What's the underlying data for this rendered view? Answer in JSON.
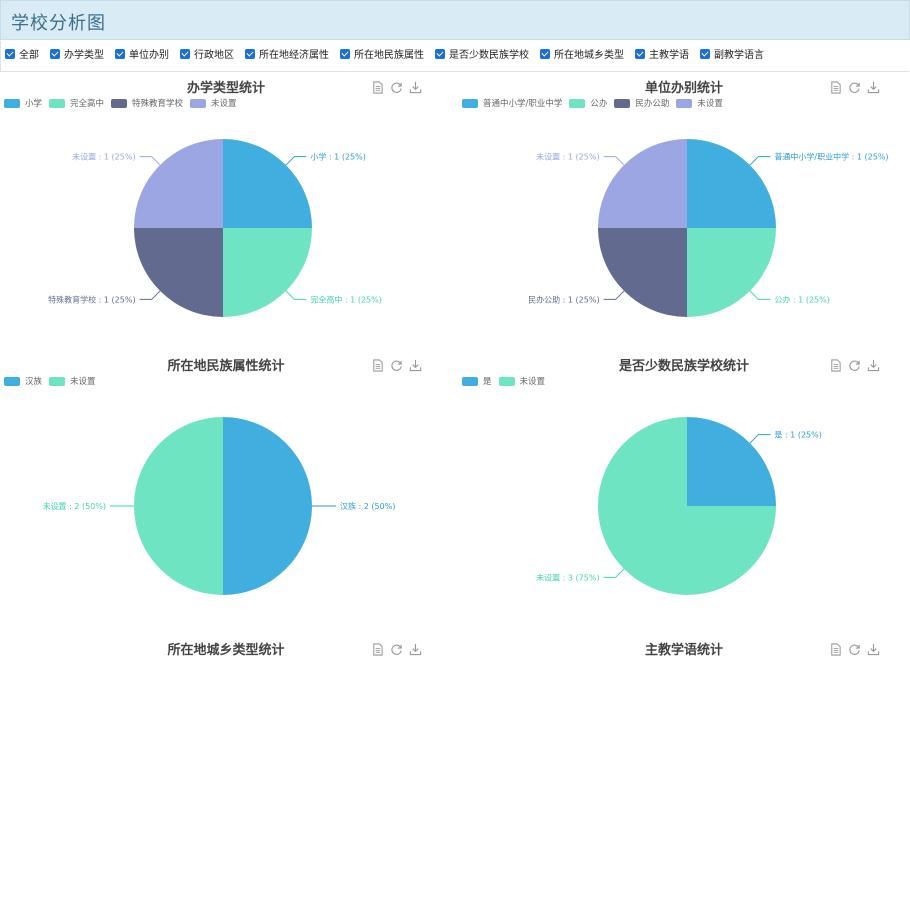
{
  "page": {
    "title": "学校分析图"
  },
  "filters": [
    {
      "label": "全部",
      "checked": true
    },
    {
      "label": "办学类型",
      "checked": true
    },
    {
      "label": "单位办别",
      "checked": true
    },
    {
      "label": "行政地区",
      "checked": true
    },
    {
      "label": "所在地经济属性",
      "checked": true
    },
    {
      "label": "所在地民族属性",
      "checked": true
    },
    {
      "label": "是否少数民族学校",
      "checked": true
    },
    {
      "label": "所在地城乡类型",
      "checked": true
    },
    {
      "label": "主教学语",
      "checked": true
    },
    {
      "label": "副教学语言",
      "checked": true
    }
  ],
  "toolbox": [
    "data-view-icon",
    "restore-icon",
    "download-icon"
  ],
  "chart_data": [
    {
      "type": "pie",
      "title": "办学类型统计",
      "legend_position": "top-left",
      "slices": [
        {
          "name": "小学",
          "value": 1,
          "percent": 25,
          "color": "#41aee0"
        },
        {
          "name": "完全高中",
          "value": 1,
          "percent": 25,
          "color": "#6ee4c2"
        },
        {
          "name": "特殊教育学校",
          "value": 1,
          "percent": 25,
          "color": "#626b8f"
        },
        {
          "name": "未设置",
          "value": 1,
          "percent": 25,
          "color": "#9ba6e2"
        }
      ]
    },
    {
      "type": "pie",
      "title": "单位办别统计",
      "legend_position": "top-left",
      "slices": [
        {
          "name": "普通中小学/职业中学",
          "value": 1,
          "percent": 25,
          "color": "#41aee0"
        },
        {
          "name": "公办",
          "value": 1,
          "percent": 25,
          "color": "#6ee4c2"
        },
        {
          "name": "民办公助",
          "value": 1,
          "percent": 25,
          "color": "#626b8f"
        },
        {
          "name": "未设置",
          "value": 1,
          "percent": 25,
          "color": "#9ba6e2"
        }
      ]
    },
    {
      "type": "pie",
      "title": "所在地民族属性统计",
      "legend_position": "top-left",
      "slices": [
        {
          "name": "汉族",
          "value": 2,
          "percent": 50,
          "color": "#41aee0"
        },
        {
          "name": "未设置",
          "value": 2,
          "percent": 50,
          "color": "#6ee4c2"
        }
      ]
    },
    {
      "type": "pie",
      "title": "是否少数民族学校统计",
      "legend_position": "top-left",
      "slices": [
        {
          "name": "是",
          "value": 1,
          "percent": 25,
          "color": "#41aee0"
        },
        {
          "name": "未设置",
          "value": 3,
          "percent": 75,
          "color": "#6ee4c2"
        }
      ]
    },
    {
      "type": "pie",
      "title": "所在地城乡类型统计",
      "slices": []
    },
    {
      "type": "pie",
      "title": "主教学语统计",
      "slices": []
    }
  ]
}
